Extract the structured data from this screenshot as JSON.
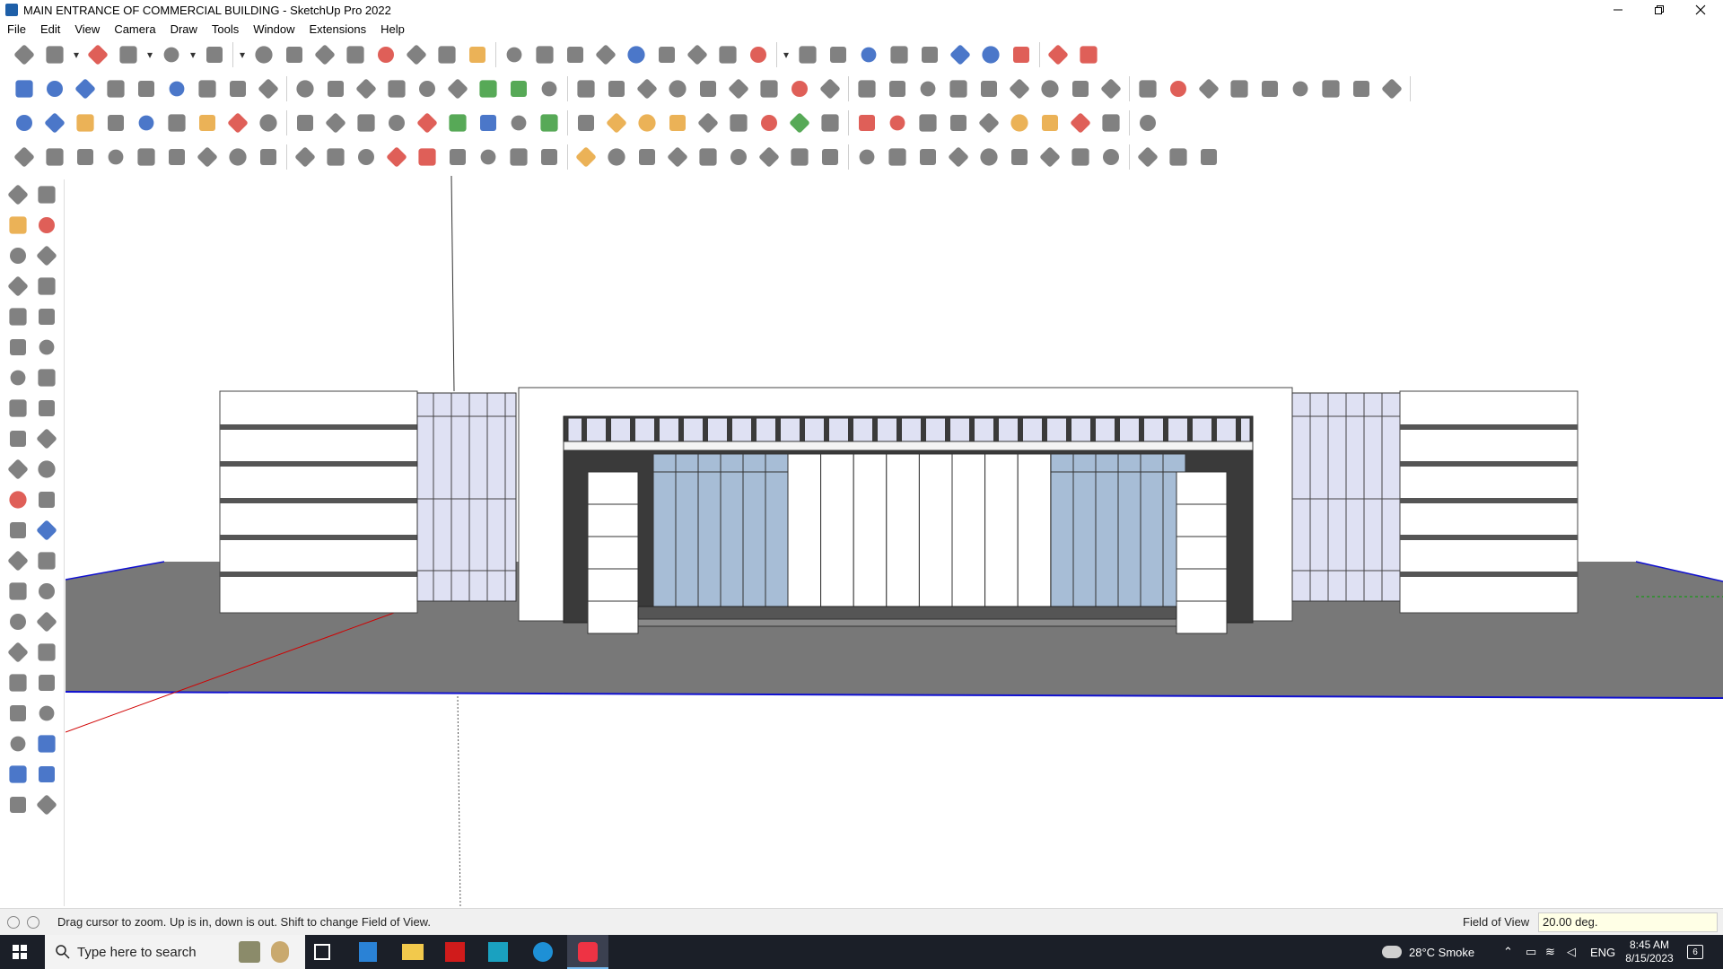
{
  "window": {
    "title": "MAIN ENTRANCE OF COMMERCIAL BUILDING - SketchUp Pro 2022",
    "minimize_icon": "minimize-icon",
    "restore_icon": "restore-icon",
    "close_icon": "close-icon"
  },
  "menu": [
    "File",
    "Edit",
    "View",
    "Camera",
    "Draw",
    "Tools",
    "Window",
    "Extensions",
    "Help"
  ],
  "toolbars": {
    "row1": [
      "search-icon",
      "select-icon",
      "dropdown-icon",
      "eraser-icon",
      "line-icon",
      "dropdown-icon",
      "arc-icon",
      "dropdown-icon",
      "rectangle-icon",
      "dropdown-icon",
      "push-pull-icon",
      "follow-me-icon",
      "move-icon",
      "rotate-icon",
      "scale-icon",
      "tape-measure-icon",
      "text-icon",
      "paint-bucket-icon",
      "orbit-icon",
      "pan-icon",
      "zoom-icon",
      "zoom-extents-icon",
      "sandbox-icon",
      "contours-icon",
      "drape-icon",
      "components-icon",
      "warehouse-icon",
      "dropdown-icon",
      "extension-icon",
      "style-icon",
      "axis-icon",
      "up-arrows-icon",
      "down-arrows-icon",
      "dimension-icon",
      "section-icon",
      "undo-icon",
      "redo-icon",
      "warehouse-red-icon"
    ],
    "row2": [
      "box-icon",
      "box2-icon",
      "box3-icon",
      "stairs-icon",
      "push-up-icon",
      "push-down-icon",
      "push-left-icon",
      "push-right-icon",
      "push-n-icon",
      "push-x-icon",
      "push-f-icon",
      "curve-icon",
      "edit-icon",
      "edit2-icon",
      "edit3-icon",
      "green-plane-icon",
      "green-arrow-icon",
      "roof-icon",
      "wall-icon",
      "house-icon",
      "house-roof-icon",
      "house-outline-icon",
      "storefront-icon",
      "formula-icon",
      "tag-icon",
      "ruler-red-icon",
      "shape-square-icon",
      "shape-circle-icon",
      "shape-hexagon-icon",
      "shape-ellipse-icon",
      "shape-parallelogram-icon",
      "shape-arch-icon",
      "shape-spiral-icon",
      "shape-lasso-icon",
      "shape-poly-icon",
      "shape-star-icon",
      "pencil-icon",
      "eraser2-icon",
      "texture-icon",
      "grid-texture-icon",
      "roof2-icon",
      "dome-icon",
      "shell-icon",
      "fence-icon",
      "ramp-icon"
    ],
    "row3": [
      "blue-plane-icon",
      "blue-plane2-icon",
      "yellow-plane-icon",
      "active-text-icon",
      "flip-icon",
      "paper-icon",
      "spiral-orange-icon",
      "red-square-icon",
      "stack-icon",
      "outline-icon",
      "wood-icon",
      "chain-icon",
      "fillet-icon",
      "polyline-red-icon",
      "plus-green-icon",
      "cross-blue-icon",
      "cone-icon",
      "tree-icon",
      "triangle-icon",
      "arc-orange-icon",
      "knot-icon",
      "knot2-icon",
      "node-icon",
      "bucket-icon",
      "loop-red-icon",
      "grid-green-icon",
      "frame-icon",
      "red-arrow-icon",
      "cube-red-icon",
      "gem-icon",
      "bracket-icon",
      "window-icon",
      "grid-orange-icon",
      "grid2-orange-icon",
      "scatter-red-icon",
      "circle-dots-icon",
      "modules-icon"
    ],
    "row4": [
      "pen-tool-icon",
      "bezier-icon",
      "hammer-icon",
      "underline-icon",
      "shape2-icon",
      "shape3-icon",
      "pipe-icon",
      "tile-icon",
      "mesh-icon",
      "slice-icon",
      "corner-icon",
      "corner2-icon",
      "line-red-icon",
      "curve-red-icon",
      "bounds-icon",
      "cone2-icon",
      "columns-icon",
      "columns2-icon",
      "fan-icon",
      "leaf-icon",
      "angle-icon",
      "stack2-icon",
      "slope-icon",
      "ribbon-icon",
      "ribbon2-icon",
      "ribbon3-icon",
      "arch2-icon",
      "diagonal-icon",
      "stair2-icon",
      "stair3-icon",
      "lattice-icon",
      "mesh2-icon",
      "lines-icon",
      "bars-icon",
      "sphere-icon",
      "star2-icon",
      "ridge-icon",
      "web-icon",
      "puzzle-icon"
    ]
  },
  "left_tools": [
    [
      "select-icon",
      "orbit-icon"
    ],
    [
      "paint-bucket-icon",
      "eraser-icon"
    ],
    [
      "components-icon",
      "pencil-icon"
    ],
    [
      "line-icon",
      "freehand-icon"
    ],
    [
      "rectangle-icon",
      "rotated-rectangle-icon"
    ],
    [
      "circle-icon",
      "polygon-icon"
    ],
    [
      "arc-icon",
      "2-point-arc-icon"
    ],
    [
      "3-point-arc-icon",
      "pie-icon"
    ],
    [
      "move-icon",
      "push-pull-icon"
    ],
    [
      "rotate-icon",
      "follow-me-icon"
    ],
    [
      "scale-icon",
      "offset-icon"
    ],
    [
      "tape-measure-icon",
      "dimension-icon"
    ],
    [
      "protractor-icon",
      "text-icon"
    ],
    [
      "axes-icon",
      "3d-text-icon"
    ],
    [
      "orbit2-icon",
      "pan-icon"
    ],
    [
      "zoom-icon",
      "zoom-window-icon"
    ],
    [
      "zoom-extents-icon",
      "previous-view-icon"
    ],
    [
      "position-camera-icon",
      "look-around-icon"
    ],
    [
      "walk-icon",
      "section-plane-icon"
    ],
    [
      "sandbox-from-contours-icon",
      "sandbox-grid-icon"
    ],
    [
      "stamp-icon",
      "drape-icon"
    ]
  ],
  "status": {
    "message": "Drag cursor to zoom.  Up is in, down is out. Shift to change Field of View.",
    "measure_label": "Field of View",
    "measure_value": "20.00 deg."
  },
  "taskbar": {
    "search_placeholder": "Type here to search",
    "weather": "28°C  Smoke",
    "language": "ENG",
    "time": "8:45 AM",
    "date": "8/15/2023",
    "notification_count": "6"
  },
  "colors": {
    "ground": "#787878",
    "glass": "#dfe1f3",
    "glass_door": "#a7bdd6",
    "wall": "#ffffff",
    "dark_wall": "#3a3a3a",
    "red_axis": "#e00000",
    "green_axis": "#00a000",
    "blue_axis": "#0000ff"
  }
}
